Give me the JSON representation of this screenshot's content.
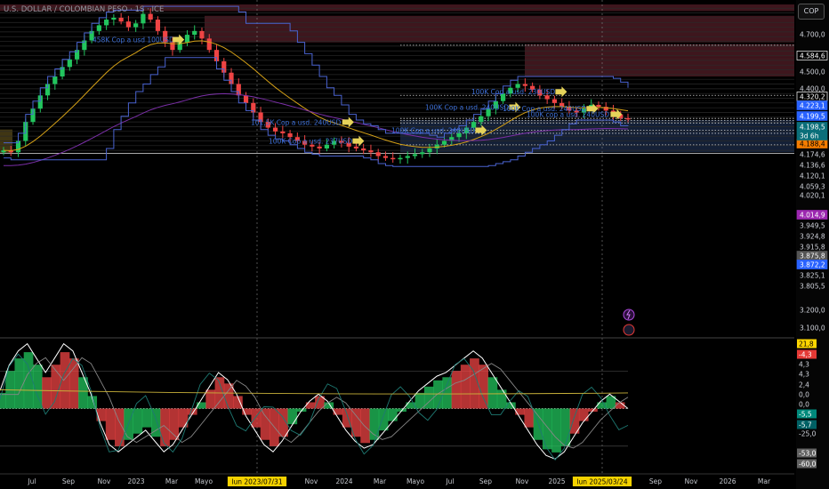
{
  "header": {
    "title": "U.S. DOLLAR / COLOMBIAN PESO · 1S · ICE",
    "currency": "COP"
  },
  "colors": {
    "bg": "#000000",
    "up": "#22c55e",
    "down": "#ef4444",
    "ema_fast": "#d4a017",
    "ema_slow": "#7b2fa8",
    "channel": "#4a63d0",
    "annotation": "#3d6fd6",
    "arrow": "#e6d35a",
    "zone": "#8a3040",
    "blue_zone": "#27406e"
  },
  "chart_data": [
    {
      "type": "line",
      "name_hint": "main-price-chart",
      "y_axis_labels": [
        "4.700,0",
        "4.500,0",
        "4.400,0",
        "4.320,2",
        "4.223,1",
        "4.199,5",
        "4.198,5",
        "4.196,1",
        "4.188,4",
        "4.174,6",
        "4.136,6",
        "4.120,1",
        "4.059,3",
        "4.020,1",
        "4.014,9",
        "3.949,5",
        "3.924,8",
        "3.915,8",
        "3.875,8",
        "3.872,2",
        "3.825,1",
        "3.805,5",
        "3.200,0",
        "3.100,0"
      ],
      "y_axis_tags": [
        {
          "label": "4.584,6",
          "style": "outlined"
        },
        {
          "label": "4.320,2",
          "style": "outlined"
        },
        {
          "label": "4.223,1",
          "style": "blue"
        },
        {
          "label": "4.199,5",
          "style": "blue"
        },
        {
          "label": "4.198,5",
          "style": "cyan"
        },
        {
          "label": "3d 6h",
          "style": "cyan"
        },
        {
          "label": "4.188,4",
          "style": "orange"
        },
        {
          "label": "4.014,9",
          "style": "magenta"
        },
        {
          "label": "3.875,8",
          "style": "gray"
        },
        {
          "label": "3.872,2",
          "style": "blue"
        }
      ],
      "x_labels": [
        "Jul",
        "Sep",
        "Nov",
        "2023",
        "Mar",
        "Mayo",
        "Sep",
        "Nov",
        "2024",
        "Mar",
        "Mayo",
        "Jul",
        "Sep",
        "Nov",
        "2025",
        "Sep",
        "Nov",
        "2026",
        "Mar"
      ],
      "crosshair_dates": [
        "lun 2023/07/31",
        "lun 2025/03/24"
      ],
      "annotations": [
        "458K Cop a usd 100USD",
        "100K Cop a usd. 230USD",
        "100K Cop a usd. 240USD",
        "101,5K Cop a usd. 240USD",
        "100K Cop a usd. 237USD",
        "100K Cop a usd. 240USD",
        "100K Cop a usd. 240USD",
        "100K cop a usd. 240USD"
      ],
      "close_series": [
        4030,
        4020,
        4080,
        4180,
        4250,
        4320,
        4380,
        4420,
        4470,
        4510,
        4560,
        4610,
        4660,
        4690,
        4720,
        4730,
        4710,
        4680,
        4700,
        4750,
        4720,
        4660,
        4600,
        4560,
        4600,
        4640,
        4660,
        4620,
        4560,
        4500,
        4440,
        4380,
        4320,
        4280,
        4230,
        4180,
        4150,
        4130,
        4120,
        4100,
        4080,
        4060,
        4050,
        4040,
        4060,
        4080,
        4070,
        4050,
        4040,
        4030,
        4020,
        4000,
        3990,
        3985,
        3990,
        4000,
        4010,
        4020,
        4040,
        4060,
        4080,
        4100,
        4120,
        4150,
        4180,
        4210,
        4250,
        4290,
        4330,
        4360,
        4380,
        4370,
        4350,
        4320,
        4300,
        4280,
        4260,
        4240,
        4230,
        4250,
        4270,
        4260,
        4240,
        4220,
        4200,
        4198.5
      ]
    },
    {
      "type": "area",
      "name_hint": "oscillator",
      "y_axis_labels": [
        "21,8",
        "-4,3",
        "4,3",
        "4,3",
        "2,4",
        "0,0",
        "0,0",
        "-5,5",
        "-5,7",
        "-25,0",
        "-53,0",
        "-60,0"
      ],
      "values": [
        5,
        12,
        16,
        18,
        14,
        10,
        14,
        18,
        16,
        10,
        4,
        -4,
        -10,
        -12,
        -10,
        -8,
        -6,
        -9,
        -12,
        -10,
        -6,
        -2,
        2,
        6,
        10,
        8,
        4,
        -2,
        -6,
        -10,
        -12,
        -9,
        -5,
        -1,
        2,
        4,
        2,
        -2,
        -6,
        -9,
        -11,
        -10,
        -7,
        -4,
        -1,
        2,
        5,
        7,
        9,
        10,
        12,
        14,
        16,
        14,
        10,
        6,
        2,
        -2,
        -6,
        -10,
        -13,
        -14,
        -12,
        -8,
        -4,
        -1,
        2,
        4,
        2,
        0
      ]
    }
  ]
}
